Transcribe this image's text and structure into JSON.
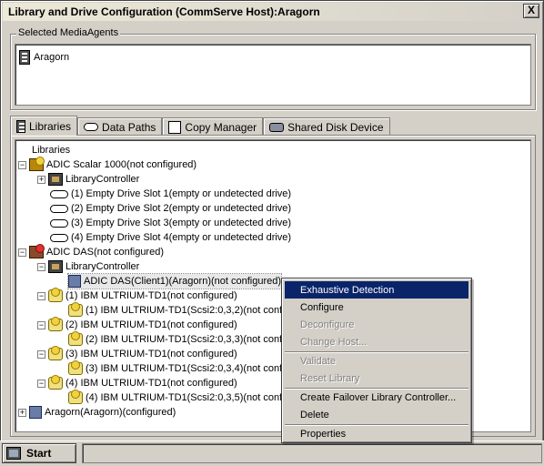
{
  "window": {
    "title": "Library and Drive Configuration (CommServe Host):Aragorn",
    "close_label": "X"
  },
  "media_agents": {
    "group_label": "Selected MediaAgents",
    "items": [
      "Aragorn"
    ]
  },
  "tabs": [
    {
      "label": "Libraries",
      "icon": "libraries-icon"
    },
    {
      "label": "Data Paths",
      "icon": "tape-icon"
    },
    {
      "label": "Copy Manager",
      "icon": "copy-icon"
    },
    {
      "label": "Shared Disk Device",
      "icon": "disk-icon"
    }
  ],
  "tree": {
    "root": "Libraries",
    "nodes": [
      "ADIC Scalar 1000(not configured)",
      "LibraryController",
      "(1) Empty Drive Slot 1(empty or undetected drive)",
      "(2) Empty Drive Slot 2(empty or undetected drive)",
      "(3) Empty Drive Slot 3(empty or undetected drive)",
      "(4) Empty Drive Slot 4(empty or undetected drive)",
      "ADIC DAS(not configured)",
      "LibraryController",
      "ADIC DAS(Client1)(Aragorn)(not configured)",
      "(1) IBM ULTRIUM-TD1(not configured)",
      "(1) IBM ULTRIUM-TD1(Scsi2:0,3,2)(not confi",
      "(2) IBM ULTRIUM-TD1(not configured)",
      "(2) IBM ULTRIUM-TD1(Scsi2:0,3,3)(not confi",
      "(3) IBM ULTRIUM-TD1(not configured)",
      "(3) IBM ULTRIUM-TD1(Scsi2:0,3,4)(not confi",
      "(4) IBM ULTRIUM-TD1(not configured)",
      "(4) IBM ULTRIUM-TD1(Scsi2:0,3,5)(not confi",
      "Aragorn(Aragorn)(configured)"
    ]
  },
  "context_menu": {
    "items": [
      {
        "label": "Exhaustive Detection",
        "state": "selected"
      },
      {
        "label": "Configure",
        "state": "enabled"
      },
      {
        "label": "Deconfigure",
        "state": "disabled"
      },
      {
        "label": "Change Host...",
        "state": "disabled"
      },
      {
        "label": "Validate",
        "state": "disabled"
      },
      {
        "label": "Reset Library",
        "state": "disabled"
      },
      {
        "label": "Create Failover Library Controller...",
        "state": "enabled"
      },
      {
        "label": "Delete",
        "state": "enabled"
      },
      {
        "label": "Properties",
        "state": "enabled"
      }
    ]
  },
  "taskbar": {
    "start_label": "Start"
  },
  "colors": {
    "menu_highlight": "#0a246a",
    "window_bg": "#d4d0c8"
  }
}
